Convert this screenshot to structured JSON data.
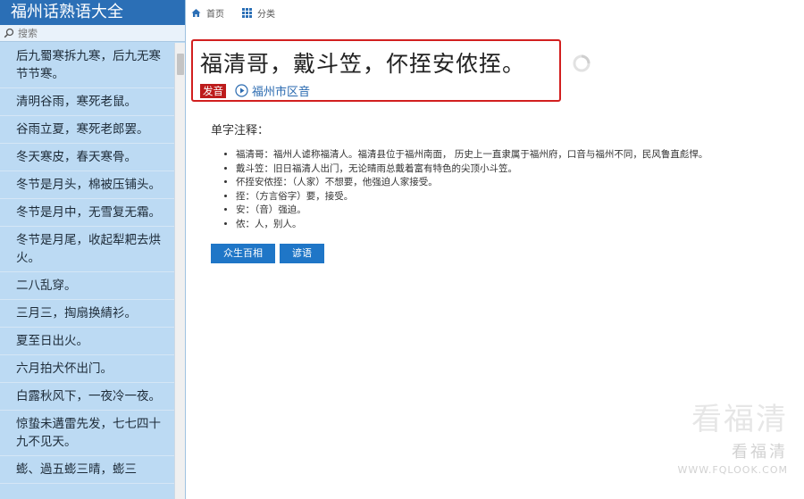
{
  "app": {
    "title": "福州话熟语大全"
  },
  "search": {
    "placeholder": "搜索"
  },
  "nav": {
    "home": "首页",
    "category": "分类"
  },
  "sidebar": {
    "items": [
      "后九蜀寒拆九寒，后九无寒节节寒。",
      "清明谷雨，寒死老鼠。",
      "谷雨立夏，寒死老郎罢。",
      "冬天寒皮，春天寒骨。",
      "冬节是月头，棉被压铺头。",
      "冬节是月中，无雪复无霜。",
      "冬节是月尾，收起犁耙去烘火。",
      "二八乱穿。",
      "三月三，掏扇换綪衫。",
      "夏至日出火。",
      "六月拍犬伓出门。",
      "白露秋风下，一夜冷一夜。",
      "惊蛰未遘雷先发，七七四十九不见天。",
      "蟛、過五蟛三晴，蟛三"
    ]
  },
  "headline": {
    "phrase": "福清哥，戴斗笠，伓挃安侬挃。",
    "pronounce_label": "发音",
    "dialect_label": "福州市区音"
  },
  "notes": {
    "title": "单字注释：",
    "items": [
      "福清哥：福州人谑称福清人。福清县位于福州南面， 历史上一直隶属于福州府，口音与福州不同，民风鲁直彪悍。",
      "戴斗笠：旧日福清人出门，无论晴雨总戴着富有特色的尖顶小斗笠。",
      "伓挃安侬挃：（人家）不想要，他强迫人家接受。",
      "挃：（方言俗字）要，接受。",
      "安：（音）强迫。",
      "侬：人，别人。"
    ]
  },
  "buttons": {
    "first": "众生百相",
    "second": "谚语"
  },
  "watermark": {
    "big": "看福清",
    "mid": "看福清",
    "url": "WWW.FQLOOK.COM"
  },
  "colors": {
    "sidebar_bg": "#bcdaf3",
    "title_bar": "#2b6fb6",
    "highlight_border": "#d21f1f",
    "badge": "#bd1c1c",
    "button": "#1f76c7",
    "link": "#2a6ab0"
  }
}
